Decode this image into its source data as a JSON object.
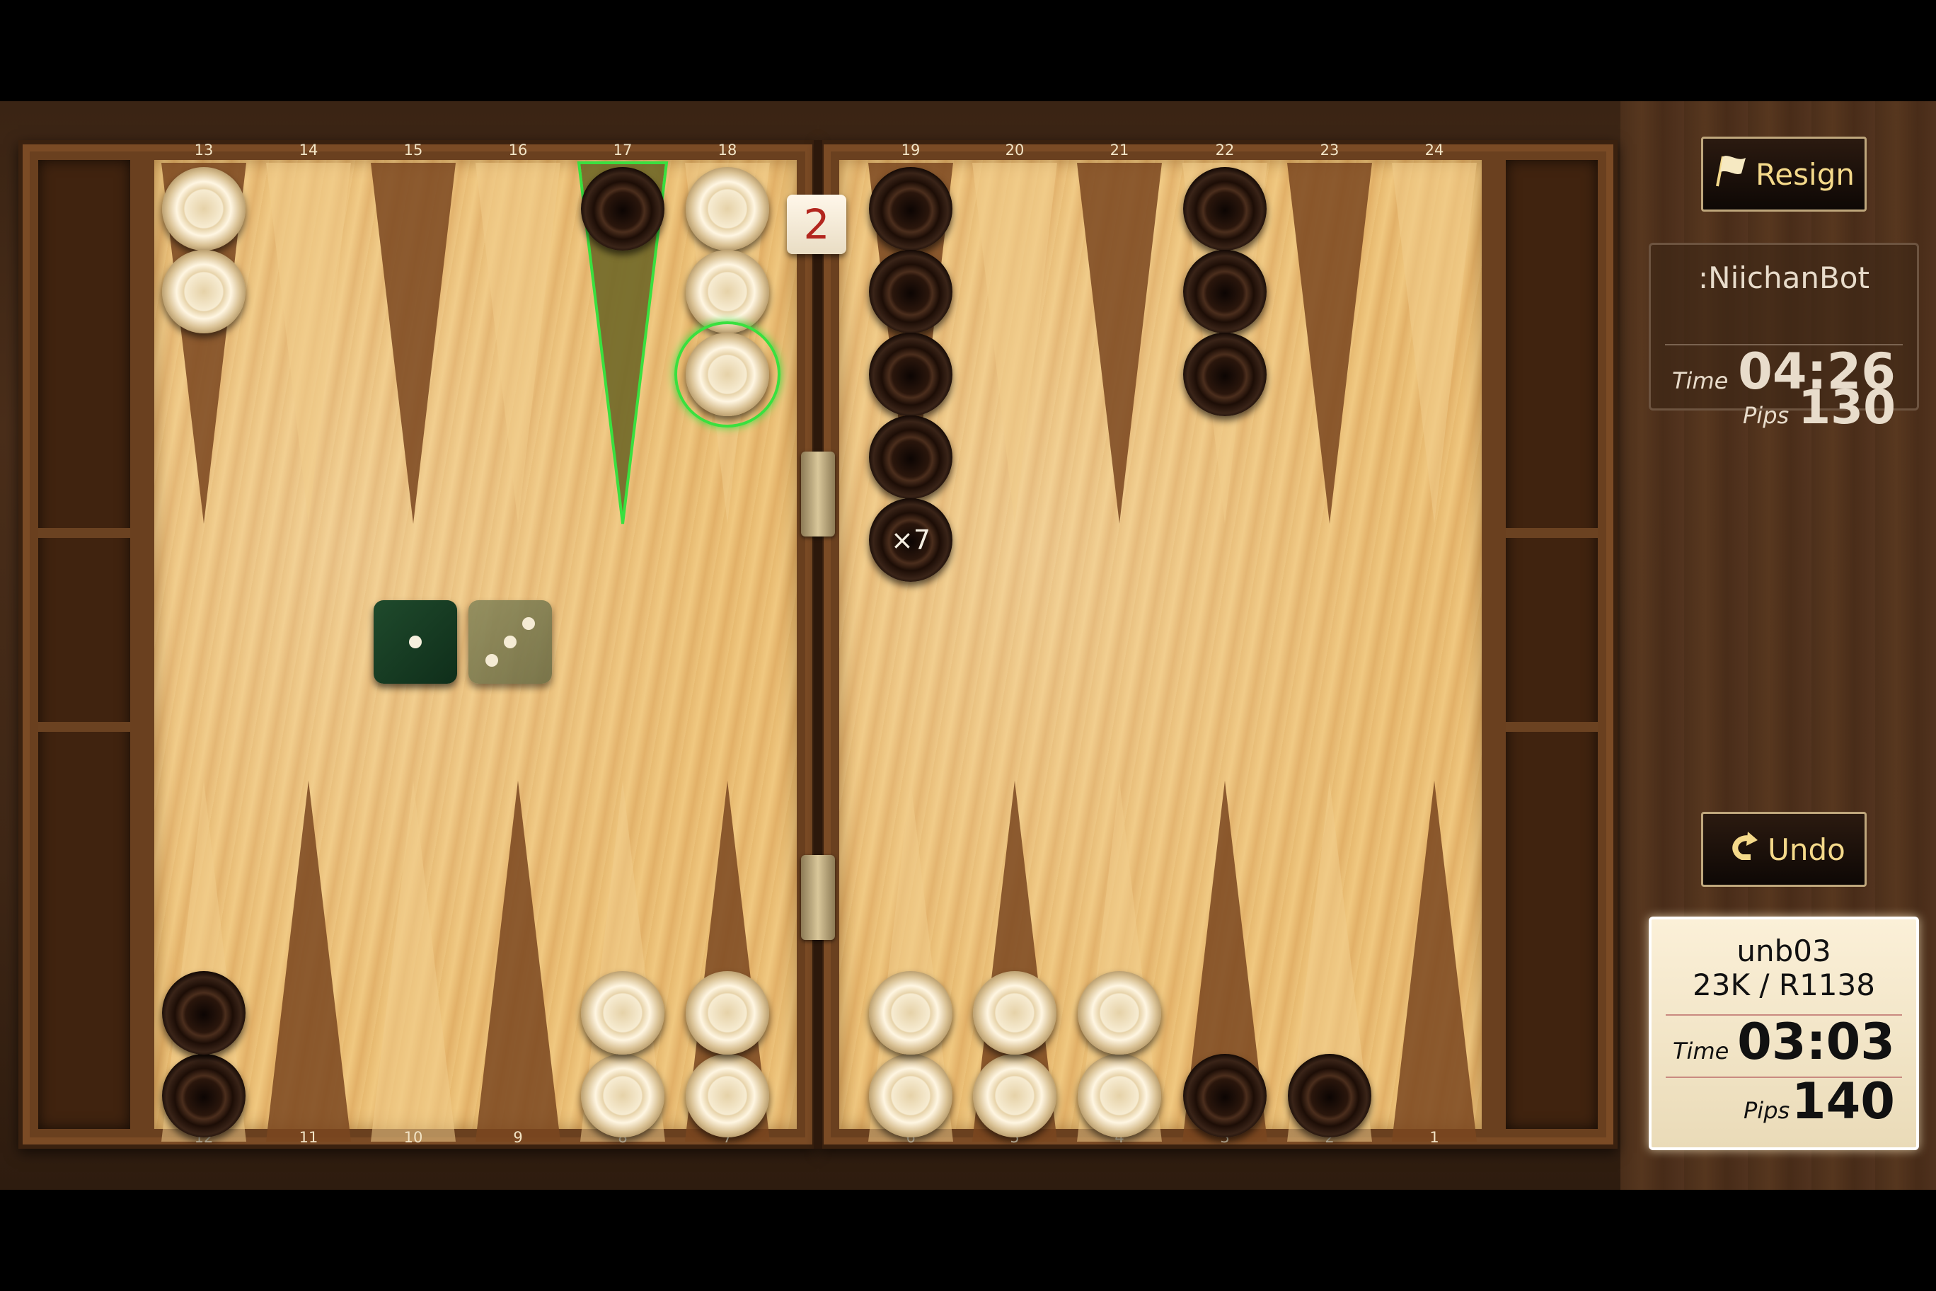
{
  "points_top": [
    "13",
    "14",
    "15",
    "16",
    "17",
    "18",
    "19",
    "20",
    "21",
    "22",
    "23",
    "24"
  ],
  "points_bottom": [
    "12",
    "11",
    "10",
    "9",
    "8",
    "7",
    "6",
    "5",
    "4",
    "3",
    "2",
    "1"
  ],
  "doubling_cube": "2",
  "stack_count_label": "×7",
  "dice": [
    {
      "name": "die-1",
      "value": 1,
      "state": "active",
      "color": "#1f4a2c"
    },
    {
      "name": "die-2",
      "value": 3,
      "state": "used",
      "color": "#7a7950"
    }
  ],
  "buttons": {
    "resign": "Resign",
    "undo": "Undo"
  },
  "opponent": {
    "name": ":NiichanBot",
    "time_label": "Time",
    "time": "04:26",
    "pips_label": "Pips",
    "pips": "130"
  },
  "player": {
    "name": "unb03",
    "rank": "23K / R1138",
    "time_label": "Time",
    "time": "03:03",
    "pips_label": "Pips",
    "pips": "140"
  },
  "colors": {
    "highlight": "#39e03f",
    "cube_number": "#b3261e",
    "button_text": "#f4d98a"
  },
  "checkers": [
    {
      "point": 13,
      "color": "white",
      "count": 2
    },
    {
      "point": 17,
      "color": "black",
      "count": 1,
      "move_hint": true
    },
    {
      "point": 18,
      "color": "white",
      "count": 3,
      "selected": true
    },
    {
      "point": 19,
      "color": "black",
      "count": 7,
      "label": "×7"
    },
    {
      "point": 22,
      "color": "black",
      "count": 3
    },
    {
      "point": 12,
      "color": "black",
      "count": 2
    },
    {
      "point": 8,
      "color": "white",
      "count": 2
    },
    {
      "point": 7,
      "color": "white",
      "count": 2
    },
    {
      "point": 6,
      "color": "white",
      "count": 2
    },
    {
      "point": 5,
      "color": "white",
      "count": 2
    },
    {
      "point": 4,
      "color": "white",
      "count": 2
    },
    {
      "point": 3,
      "color": "black",
      "count": 1
    },
    {
      "point": 2,
      "color": "black",
      "count": 1
    }
  ]
}
